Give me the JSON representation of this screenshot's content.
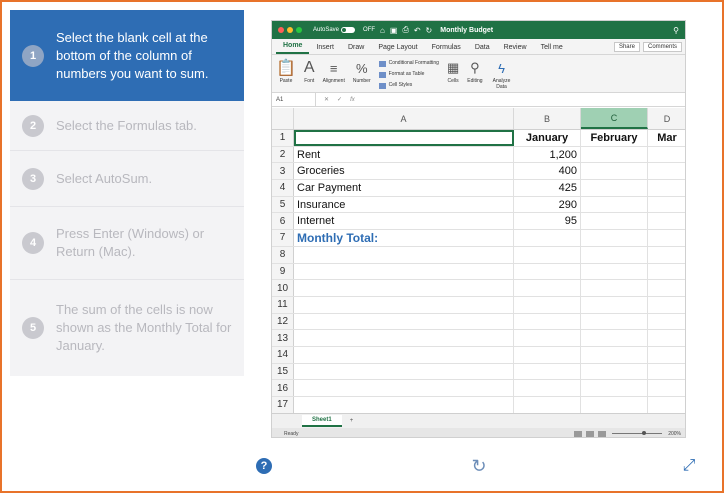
{
  "steps": [
    {
      "number": "1",
      "text": "Select the blank cell at the bottom of the column of numbers you want to sum."
    },
    {
      "number": "2",
      "text": "Select the Formulas tab."
    },
    {
      "number": "3",
      "text": "Select AutoSum."
    },
    {
      "number": "4",
      "text": "Press Enter (Windows) or Return (Mac)."
    },
    {
      "number": "5",
      "text": "The sum of the cells is now shown as the Monthly Total for January."
    }
  ],
  "excel": {
    "autosave_label": "AutoSave",
    "autosave_state": "OFF",
    "document_title": "Monthly Budget",
    "tabs": [
      "Home",
      "Insert",
      "Draw",
      "Page Layout",
      "Formulas",
      "Data",
      "Review",
      "Tell me"
    ],
    "share_label": "Share",
    "comments_label": "Comments",
    "ribbon": {
      "paste": "Paste",
      "font": "Font",
      "alignment": "Alignment",
      "number": "Number",
      "conditional_formatting": "Conditional Formatting",
      "format_as_table": "Format as Table",
      "cell_styles": "Cell Styles",
      "cells": "Cells",
      "editing": "Editing",
      "analyze_data": "Analyze Data"
    },
    "namebox": "A1",
    "fx": "fx",
    "columns": [
      "A",
      "B",
      "C",
      "D"
    ],
    "rows": [
      {
        "n": "1",
        "a": "",
        "b": "January",
        "c": "February",
        "d": "Mar"
      },
      {
        "n": "2",
        "a": "Rent",
        "b": "1,200",
        "c": "",
        "d": ""
      },
      {
        "n": "3",
        "a": "Groceries",
        "b": "400",
        "c": "",
        "d": ""
      },
      {
        "n": "4",
        "a": "Car Payment",
        "b": "425",
        "c": "",
        "d": ""
      },
      {
        "n": "5",
        "a": "Insurance",
        "b": "290",
        "c": "",
        "d": ""
      },
      {
        "n": "6",
        "a": "Internet",
        "b": "95",
        "c": "",
        "d": ""
      },
      {
        "n": "7",
        "a": "Monthly Total:",
        "b": "",
        "c": "",
        "d": ""
      },
      {
        "n": "8",
        "a": "",
        "b": "",
        "c": "",
        "d": ""
      },
      {
        "n": "9",
        "a": "",
        "b": "",
        "c": "",
        "d": ""
      },
      {
        "n": "10",
        "a": "",
        "b": "",
        "c": "",
        "d": ""
      },
      {
        "n": "11",
        "a": "",
        "b": "",
        "c": "",
        "d": ""
      },
      {
        "n": "12",
        "a": "",
        "b": "",
        "c": "",
        "d": ""
      },
      {
        "n": "13",
        "a": "",
        "b": "",
        "c": "",
        "d": ""
      },
      {
        "n": "14",
        "a": "",
        "b": "",
        "c": "",
        "d": ""
      },
      {
        "n": "15",
        "a": "",
        "b": "",
        "c": "",
        "d": ""
      },
      {
        "n": "16",
        "a": "",
        "b": "",
        "c": "",
        "d": ""
      },
      {
        "n": "17",
        "a": "",
        "b": "",
        "c": "",
        "d": ""
      }
    ],
    "sheet_tab": "Sheet1",
    "add_sheet": "+",
    "status": "Ready",
    "zoom": "200%"
  },
  "footer": {
    "help_glyph": "?",
    "reload_glyph": "↻",
    "expand_glyph": "⤢"
  },
  "colors": {
    "accent": "#2e6db4",
    "excel_green": "#207245",
    "frame": "#e8732a"
  }
}
